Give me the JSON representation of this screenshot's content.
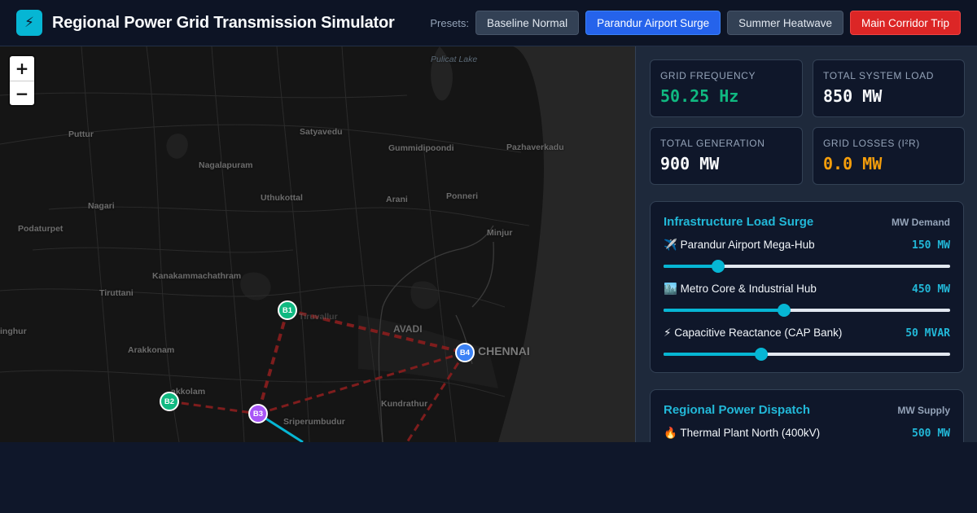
{
  "header": {
    "logo_icon": "lightning-bolt-icon",
    "title": "Regional Power Grid Transmission Simulator",
    "presets_label": "Presets:",
    "presets": [
      {
        "label": "Baseline Normal",
        "state": "default"
      },
      {
        "label": "Parandur Airport Surge",
        "state": "active"
      },
      {
        "label": "Summer Heatwave",
        "state": "default"
      },
      {
        "label": "Main Corridor Trip",
        "state": "danger"
      }
    ]
  },
  "map": {
    "zoom_in": "+",
    "zoom_out": "−",
    "places": {
      "pulicat": "Pulicat Lake",
      "puttur": "Puttur",
      "satyavedu": "Satyavedu",
      "gummidipoondi": "Gummidipoondi",
      "pazhaverkadu": "Pazhaverkadu",
      "nagalapuram": "Nagalapuram",
      "uthukottai": "Uthukottal",
      "arani": "Arani",
      "ponneri": "Ponneri",
      "nagari": "Nagari",
      "podaturpet": "Podaturpet",
      "minjur": "Minjur",
      "kanakammachathram": "Kanakammachathram",
      "tiruttani": "Tiruttani",
      "tiruvallur": "Tiruvallur",
      "avadi": "AVADI",
      "chennai": "CHENNAI",
      "singhur": "inghur",
      "arakkonam": "Arakkonam",
      "kanchipuram": "akkolam",
      "kundrathur": "Kundrathur",
      "sriperumbudur": "Sriperumbudur"
    },
    "buses": [
      {
        "label": "B1",
        "color": "#10b981"
      },
      {
        "label": "B2",
        "color": "#10b981"
      },
      {
        "label": "B3",
        "color": "#a855f7"
      },
      {
        "label": "B4",
        "color": "#3b82f6"
      }
    ],
    "line_colors": {
      "loaded": "#7f1d1d",
      "active": "#06b6d4"
    }
  },
  "stats": {
    "frequency": {
      "label": "GRID FREQUENCY",
      "value": "50.25 Hz",
      "color": "#10b981"
    },
    "load": {
      "label": "TOTAL SYSTEM LOAD",
      "value": "850 MW",
      "color": "#f8fafc"
    },
    "generation": {
      "label": "TOTAL GENERATION",
      "value": "900 MW",
      "color": "#f8fafc"
    },
    "losses": {
      "label": "GRID LOSSES (I²R)",
      "value": "0.0 MW",
      "color": "#f59e0b"
    }
  },
  "load_surge": {
    "title": "Infrastructure Load Surge",
    "unit": "MW Demand",
    "controls": [
      {
        "icon": "airplane-icon",
        "glyph": "✈️",
        "label": "Parandur Airport Mega-Hub",
        "value": "150 MW",
        "level": 0.19
      },
      {
        "icon": "city-icon",
        "glyph": "🏙️",
        "label": "Metro Core & Industrial Hub",
        "value": "450 MW",
        "level": 0.42
      },
      {
        "icon": "lightning-icon",
        "glyph": "⚡",
        "label": "Capacitive Reactance (CAP Bank)",
        "value": "50 MVAR",
        "level": 0.34
      }
    ]
  },
  "dispatch": {
    "title": "Regional Power Dispatch",
    "unit": "MW Supply",
    "first_item": {
      "icon": "fire-icon",
      "glyph": "🔥",
      "label": "Thermal Plant North (400kV)",
      "value": "500 MW"
    }
  }
}
